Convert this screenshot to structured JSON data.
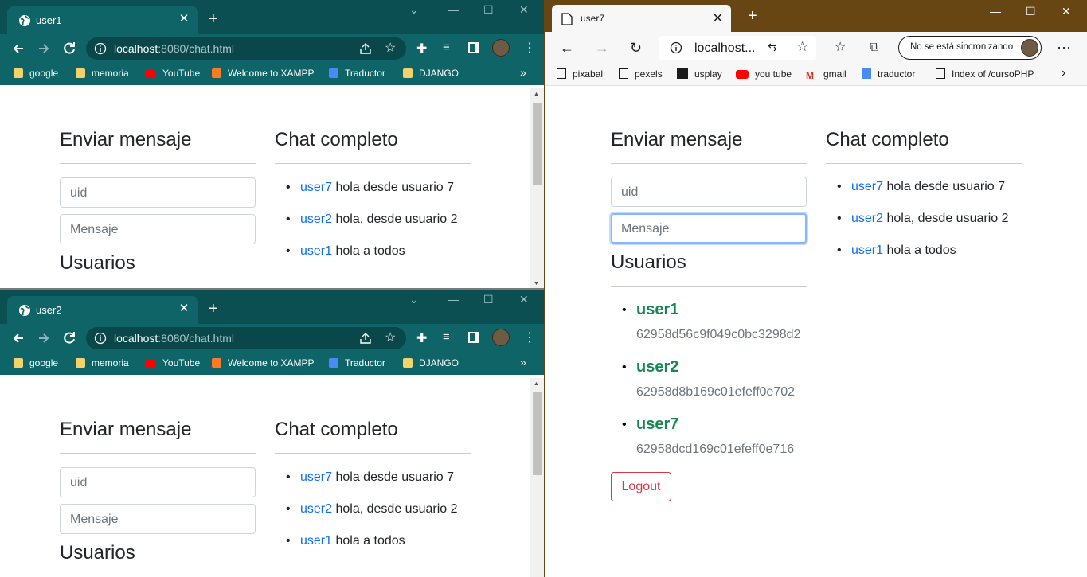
{
  "windows": {
    "chrome1": {
      "tab_title": "user1",
      "url_host": "localhost",
      "url_rest": ":8080/chat.html",
      "bookmarks": [
        "google",
        "memoria",
        "YouTube",
        "Welcome to XAMPP",
        "Traductor",
        "DJANGO"
      ],
      "overflow": "»"
    },
    "chrome2": {
      "tab_title": "user2",
      "url_host": "localhost",
      "url_rest": ":8080/chat.html",
      "bookmarks": [
        "google",
        "memoria",
        "YouTube",
        "Welcome to XAMPP",
        "Traductor",
        "DJANGO"
      ],
      "overflow": "»"
    },
    "edge": {
      "tab_title": "user7",
      "url": "localhost...",
      "sync_label": "No se está sincronizando",
      "bookmarks": [
        "pixabal",
        "pexels",
        "usplay",
        "you tube",
        "gmail",
        "traductor",
        "Index of /cursoPHP"
      ]
    }
  },
  "page": {
    "send_title": "Enviar mensaje",
    "chat_title": "Chat completo",
    "users_title": "Usuarios",
    "uid_placeholder": "uid",
    "message_placeholder": "Mensaje",
    "logout_label": "Logout",
    "messages": [
      {
        "user": "user7",
        "text": "hola desde usuario 7"
      },
      {
        "user": "user2",
        "text": "hola, desde usuario 2"
      },
      {
        "user": "user1",
        "text": "hola a todos"
      }
    ],
    "users": [
      {
        "name": "user1",
        "id": "62958d56c9f049c0bc3298d2"
      },
      {
        "name": "user2",
        "id": "62958d8b169c01efeff0e702"
      },
      {
        "name": "user7",
        "id": "62958dcd169c01efeff0e716"
      }
    ]
  },
  "colors": {
    "chrome_frame": "#0b4f53",
    "chrome_toolbar": "#0f6468",
    "edge_frame": "#684614",
    "link": "#0d6efd",
    "user_green": "#198754",
    "danger": "#dc3545"
  },
  "icons": [
    "globe-icon",
    "close-icon",
    "plus-icon",
    "back-icon",
    "forward-icon",
    "reload-icon",
    "info-icon",
    "share-icon",
    "star-icon",
    "extensions-icon",
    "media-icon",
    "sidepanel-icon",
    "menu-icon",
    "folder-icon",
    "youtube-icon",
    "xampp-icon",
    "translate-icon",
    "page-icon",
    "gmail-icon",
    "chevron-right-icon"
  ]
}
